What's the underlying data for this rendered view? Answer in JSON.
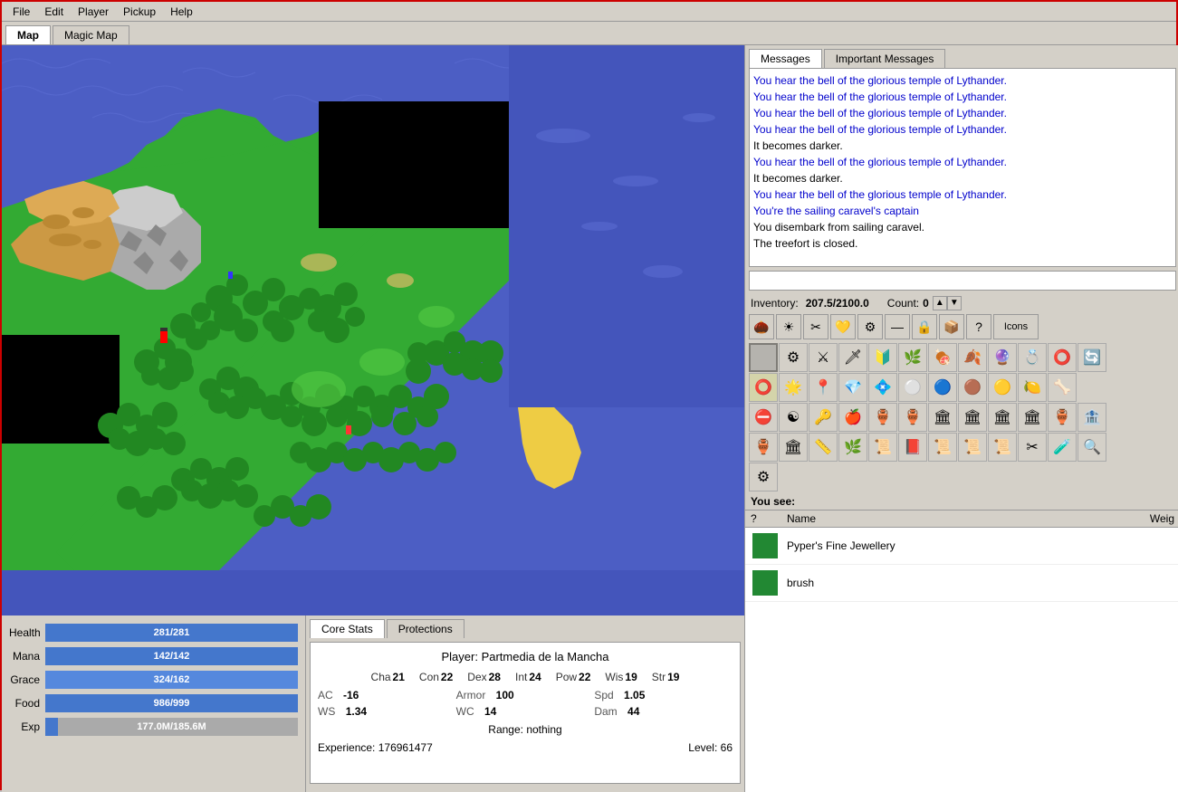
{
  "menu": {
    "items": [
      "File",
      "Edit",
      "Player",
      "Pickup",
      "Help"
    ]
  },
  "map_tabs": [
    {
      "label": "Map",
      "active": true
    },
    {
      "label": "Magic Map",
      "active": false
    }
  ],
  "messages_tabs": [
    {
      "label": "Messages",
      "active": true
    },
    {
      "label": "Important Messages",
      "active": false
    }
  ],
  "messages": [
    {
      "text": "You hear the bell of the glorious temple of Lythander.",
      "type": "blue"
    },
    {
      "text": "You hear the bell of the glorious temple of Lythander.",
      "type": "blue"
    },
    {
      "text": "You hear the bell of the glorious temple of Lythander.",
      "type": "blue"
    },
    {
      "text": "You hear the bell of the glorious temple of Lythander.",
      "type": "blue"
    },
    {
      "text": "It becomes darker.",
      "type": "black"
    },
    {
      "text": "You hear the bell of the glorious temple of Lythander.",
      "type": "blue"
    },
    {
      "text": "It becomes darker.",
      "type": "black"
    },
    {
      "text": "You hear the bell of the glorious temple of Lythander.",
      "type": "blue"
    },
    {
      "text": "You're the sailing caravel's captain",
      "type": "blue"
    },
    {
      "text": "You disembark from sailing caravel.",
      "type": "black"
    },
    {
      "text": "The treefort is closed.",
      "type": "black"
    }
  ],
  "inventory": {
    "label": "Inventory:",
    "weight": "207.5/2100.0",
    "count_label": "Count:",
    "count": "0"
  },
  "inv_toolbar": {
    "icons_label": "Icons"
  },
  "stats": {
    "health_label": "Health",
    "health_current": 281,
    "health_max": 281,
    "health_text": "281/281",
    "mana_label": "Mana",
    "mana_current": 142,
    "mana_max": 142,
    "mana_text": "142/142",
    "grace_label": "Grace",
    "grace_current": 324,
    "grace_max": 162,
    "grace_text": "324/162",
    "food_label": "Food",
    "food_current": 986,
    "food_max": 999,
    "food_text": "986/999",
    "exp_label": "Exp",
    "exp_current": "177.0M",
    "exp_max": "185.6M",
    "exp_text": "177.0M/185.6M"
  },
  "core_stats_tabs": [
    {
      "label": "Core Stats",
      "active": true
    },
    {
      "label": "Protections",
      "active": false
    }
  ],
  "player": {
    "name": "Partmedia de la Mancha",
    "cha": 21,
    "con": 22,
    "dex": 28,
    "int": 24,
    "pow": 22,
    "wis": 19,
    "str": 19,
    "ac_label": "AC",
    "ac": "-16",
    "armor_label": "Armor",
    "armor": "100",
    "spd_label": "Spd",
    "spd": "1.05",
    "ws_label": "WS",
    "ws": "1.34",
    "wc_label": "WC",
    "wc": "14",
    "dam_label": "Dam",
    "dam": "44",
    "range_label": "Range:",
    "range_value": "nothing",
    "exp_label": "Experience:",
    "exp_value": "176961477",
    "level_label": "Level:",
    "level_value": "66"
  },
  "you_see": {
    "label": "You see:",
    "cols": [
      "?",
      "Name",
      "Weig"
    ],
    "items": [
      {
        "icon": "💎",
        "name": "Pyper's Fine Jewellery",
        "icon_color": "#228833"
      },
      {
        "icon": "🖌",
        "name": "brush",
        "icon_color": "#228833"
      }
    ]
  }
}
